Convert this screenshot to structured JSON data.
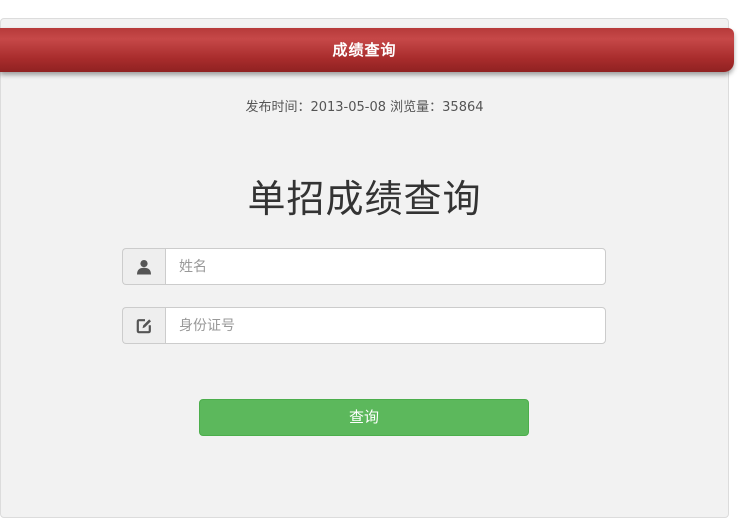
{
  "header": {
    "title": "成绩查询",
    "accent_color": "#b03535"
  },
  "meta": {
    "text": "发布时间：2013-05-08 浏览量：35864"
  },
  "form": {
    "heading": "单招成绩查询",
    "name_field": {
      "icon": "user-icon",
      "placeholder": "姓名",
      "value": ""
    },
    "id_field": {
      "icon": "edit-icon",
      "placeholder": "身份证号",
      "value": ""
    },
    "submit_label": "查询",
    "submit_color": "#5cb85c"
  }
}
